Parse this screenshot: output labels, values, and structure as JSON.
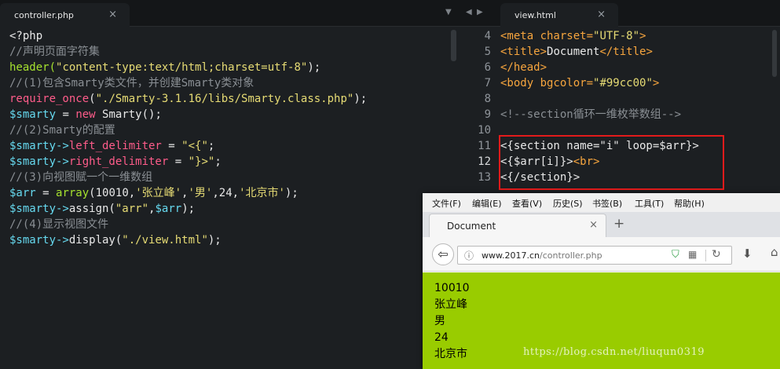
{
  "left_editor": {
    "tab_title": "controller.php",
    "tab_close": "×",
    "lines": [
      [
        {
          "t": "<?php",
          "c": "t"
        }
      ],
      [
        {
          "t": "//声明页面字符集",
          "c": "c"
        }
      ],
      [
        {
          "t": "header(",
          "c": "g"
        },
        {
          "t": "\"content-type:text/html;charset=utf-8\"",
          "c": "s"
        },
        {
          "t": ");",
          "c": "t"
        }
      ],
      [
        {
          "t": "//(1)包含Smarty类文件，并创建Smarty类对象",
          "c": "c"
        }
      ],
      [
        {
          "t": "require_once",
          "c": "p"
        },
        {
          "t": "(",
          "c": "t"
        },
        {
          "t": "\"./Smarty-3.1.16/libs/Smarty.class.php\"",
          "c": "s"
        },
        {
          "t": ");",
          "c": "t"
        }
      ],
      [
        {
          "t": "$smarty",
          "c": "b"
        },
        {
          "t": " = ",
          "c": "t"
        },
        {
          "t": "new",
          "c": "p"
        },
        {
          "t": " Smarty();",
          "c": "t"
        }
      ],
      [
        {
          "t": "//(2)Smarty的配置",
          "c": "c"
        }
      ],
      [
        {
          "t": "$smarty->",
          "c": "b"
        },
        {
          "t": "left_delimiter",
          "c": "p"
        },
        {
          "t": " = ",
          "c": "t"
        },
        {
          "t": "\"<{\"",
          "c": "s"
        },
        {
          "t": ";",
          "c": "t"
        }
      ],
      [
        {
          "t": "$smarty->",
          "c": "b"
        },
        {
          "t": "right_delimiter",
          "c": "p"
        },
        {
          "t": " = ",
          "c": "t"
        },
        {
          "t": "\"}>\"",
          "c": "s"
        },
        {
          "t": ";",
          "c": "t"
        }
      ],
      [
        {
          "t": "//(3)向视图赋一个一维数组",
          "c": "c"
        }
      ],
      [
        {
          "t": "$arr",
          "c": "b"
        },
        {
          "t": " = ",
          "c": "t"
        },
        {
          "t": "array",
          "c": "g"
        },
        {
          "t": "(10010,",
          "c": "t"
        },
        {
          "t": "'张立峰'",
          "c": "s"
        },
        {
          "t": ",",
          "c": "t"
        },
        {
          "t": "'男'",
          "c": "s"
        },
        {
          "t": ",24,",
          "c": "t"
        },
        {
          "t": "'北京市'",
          "c": "s"
        },
        {
          "t": ");",
          "c": "t"
        }
      ],
      [
        {
          "t": "$smarty->",
          "c": "b"
        },
        {
          "t": "assign(",
          "c": "t"
        },
        {
          "t": "\"arr\"",
          "c": "s"
        },
        {
          "t": ",",
          "c": "t"
        },
        {
          "t": "$arr",
          "c": "b"
        },
        {
          "t": ");",
          "c": "t"
        }
      ],
      [
        {
          "t": "//(4)显示视图文件",
          "c": "c"
        }
      ],
      [
        {
          "t": "$smarty->",
          "c": "b"
        },
        {
          "t": "display(",
          "c": "t"
        },
        {
          "t": "\"./view.html\"",
          "c": "s"
        },
        {
          "t": ");",
          "c": "t"
        }
      ]
    ]
  },
  "right_editor": {
    "tab_title": "view.html",
    "tab_close": "×",
    "line_numbers": [
      "4",
      "5",
      "6",
      "7",
      "8",
      "9",
      "10",
      "11",
      "12",
      "13"
    ],
    "lines": [
      [
        {
          "t": "<meta ",
          "c": "o"
        },
        {
          "t": "charset=",
          "c": "o"
        },
        {
          "t": "\"UTF-8\"",
          "c": "s"
        },
        {
          "t": ">",
          "c": "o"
        }
      ],
      [
        {
          "t": "<title>",
          "c": "o"
        },
        {
          "t": "Document",
          "c": "t"
        },
        {
          "t": "</title>",
          "c": "o"
        }
      ],
      [
        {
          "t": "</head>",
          "c": "o"
        }
      ],
      [
        {
          "t": "<body ",
          "c": "o"
        },
        {
          "t": "bgcolor=",
          "c": "o"
        },
        {
          "t": "\"#99cc00\"",
          "c": "s"
        },
        {
          "t": ">",
          "c": "o"
        }
      ],
      [],
      [
        {
          "t": "<!--section循环一维枚举数组-->",
          "c": "c"
        }
      ],
      [],
      [
        {
          "t": "<{section name=\"i\" loop=$arr}>",
          "c": "t"
        }
      ],
      [
        {
          "t": "<{$arr[i]}>",
          "c": "t"
        },
        {
          "t": "<br>",
          "c": "o"
        }
      ],
      [
        {
          "t": "<{/section}>",
          "c": "t"
        }
      ]
    ]
  },
  "browser": {
    "menu": [
      "文件(F)",
      "编辑(E)",
      "查看(V)",
      "历史(S)",
      "书签(B)",
      "工具(T)",
      "帮助(H)"
    ],
    "tab_title": "Document",
    "tab_close": "×",
    "new_tab": "+",
    "url_domain": "www.2017.cn",
    "url_path": "/controller.php",
    "output": [
      "10010",
      "张立峰",
      "男",
      "24",
      "北京市"
    ],
    "page_bgcolor": "#99cc00"
  },
  "watermark": "https://blog.csdn.net/liuqun0319",
  "colors": {
    "highlight_box": "#e31b1b",
    "editor_bg": "#1c1f22"
  }
}
